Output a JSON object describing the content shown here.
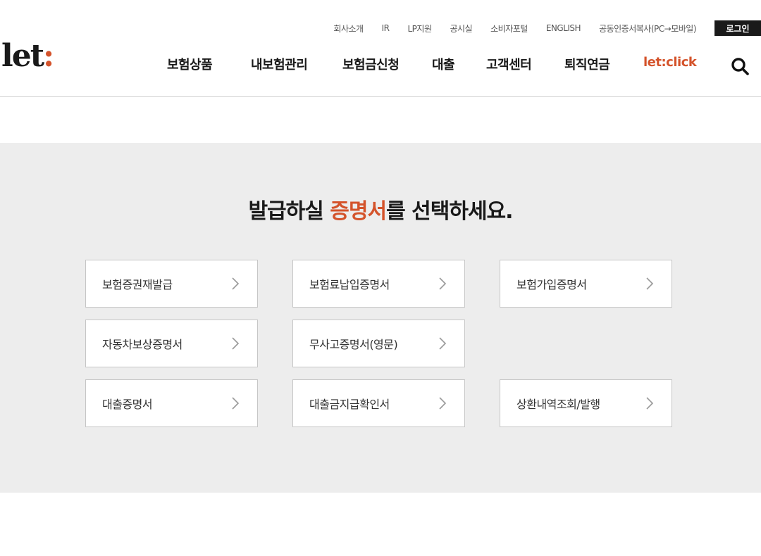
{
  "header": {
    "util_links": [
      "회사소개",
      "IR",
      "LP지원",
      "공시실",
      "소비자포털",
      "ENGLISH",
      "공동인증서복사(PC→모바일)"
    ],
    "login": "로그인",
    "logo_text": "let",
    "logo_colon": ":",
    "gnb": [
      "보험상품",
      "내보험관리",
      "보험금신청",
      "대출",
      "고객센터",
      "퇴직연금",
      "let:click"
    ]
  },
  "main": {
    "headline_pre": "발급하실 ",
    "headline_highlight": "증명서",
    "headline_post": "를 선택하세요.",
    "cards": [
      "보험증권재발급",
      "보험료납입증명서",
      "보험가입증명서",
      "자동차보상증명서",
      "무사고증명서(영문)",
      "대출증명서",
      "대출금지급확인서",
      "상환내역조회/발행"
    ]
  },
  "colors": {
    "accent": "#d4532b",
    "content_bg": "#ededed",
    "text_dark": "#1a1a1a",
    "login_bg": "#1a1a1a"
  },
  "icons": {
    "search": "search-icon",
    "arrow": "chevron-right-icon"
  }
}
